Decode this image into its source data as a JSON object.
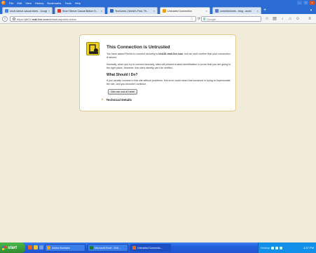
{
  "menu": {
    "items": [
      "File",
      "Edit",
      "View",
      "History",
      "Bookmarks",
      "Tools",
      "Help"
    ]
  },
  "tabs": [
    {
      "label": "short sleeve casual shirts - Google",
      "favicon_color": "#4285f4"
    },
    {
      "label": "Short Sleeve Casual Button D...",
      "favicon_color": "#d83b2a"
    },
    {
      "label": "TechLines | World's First, Th...",
      "favicon_color": "#2a6cd3"
    },
    {
      "label": "Untrusted Connection",
      "favicon_color": "#e9a11a",
      "active": true
    },
    {
      "label": "cornerhelmets - blog - world",
      "favicon_color": "#5b7bd5"
    }
  ],
  "new_tab_label": "+",
  "overflow_label": "▾",
  "navbar": {
    "url_prefix": "https://jtb13.",
    "url_host": "mail.live.com",
    "url_suffix": "/default.aspx#!n=inbox",
    "search_engine": "g",
    "search_placeholder": "Google"
  },
  "error": {
    "title": "This Connection is Untrusted",
    "intro_pre": "You have asked Firefox to connect securely to ",
    "intro_host": "blu181.mail.live.com",
    "intro_post": ", but we can't confirm that your connection is secure.",
    "normally": "Normally, when you try to connect securely, sites will present trusted identification to prove that you are going to the right place. However, this site's identity can't be verified.",
    "what_heading": "What Should I Do?",
    "usually": "If you usually connect to this site without problems, this error could mean that someone is trying to impersonate the site, and you shouldn't continue.",
    "get_out_button": "Get me out of here!",
    "technical_details": "Technical Details"
  },
  "taskbar": {
    "start_label": "start",
    "tasks": [
      {
        "label": "Adobe Illustrator",
        "icon_color": "#f39c12"
      },
      {
        "label": "Microsoft Excel - Didi...",
        "icon_color": "#1f7a3a"
      },
      {
        "label": "Untrusted Connectio...",
        "icon_color": "#e9661a",
        "active": true
      }
    ],
    "tray_label": "Desktop",
    "clock": "4:37 PM"
  }
}
